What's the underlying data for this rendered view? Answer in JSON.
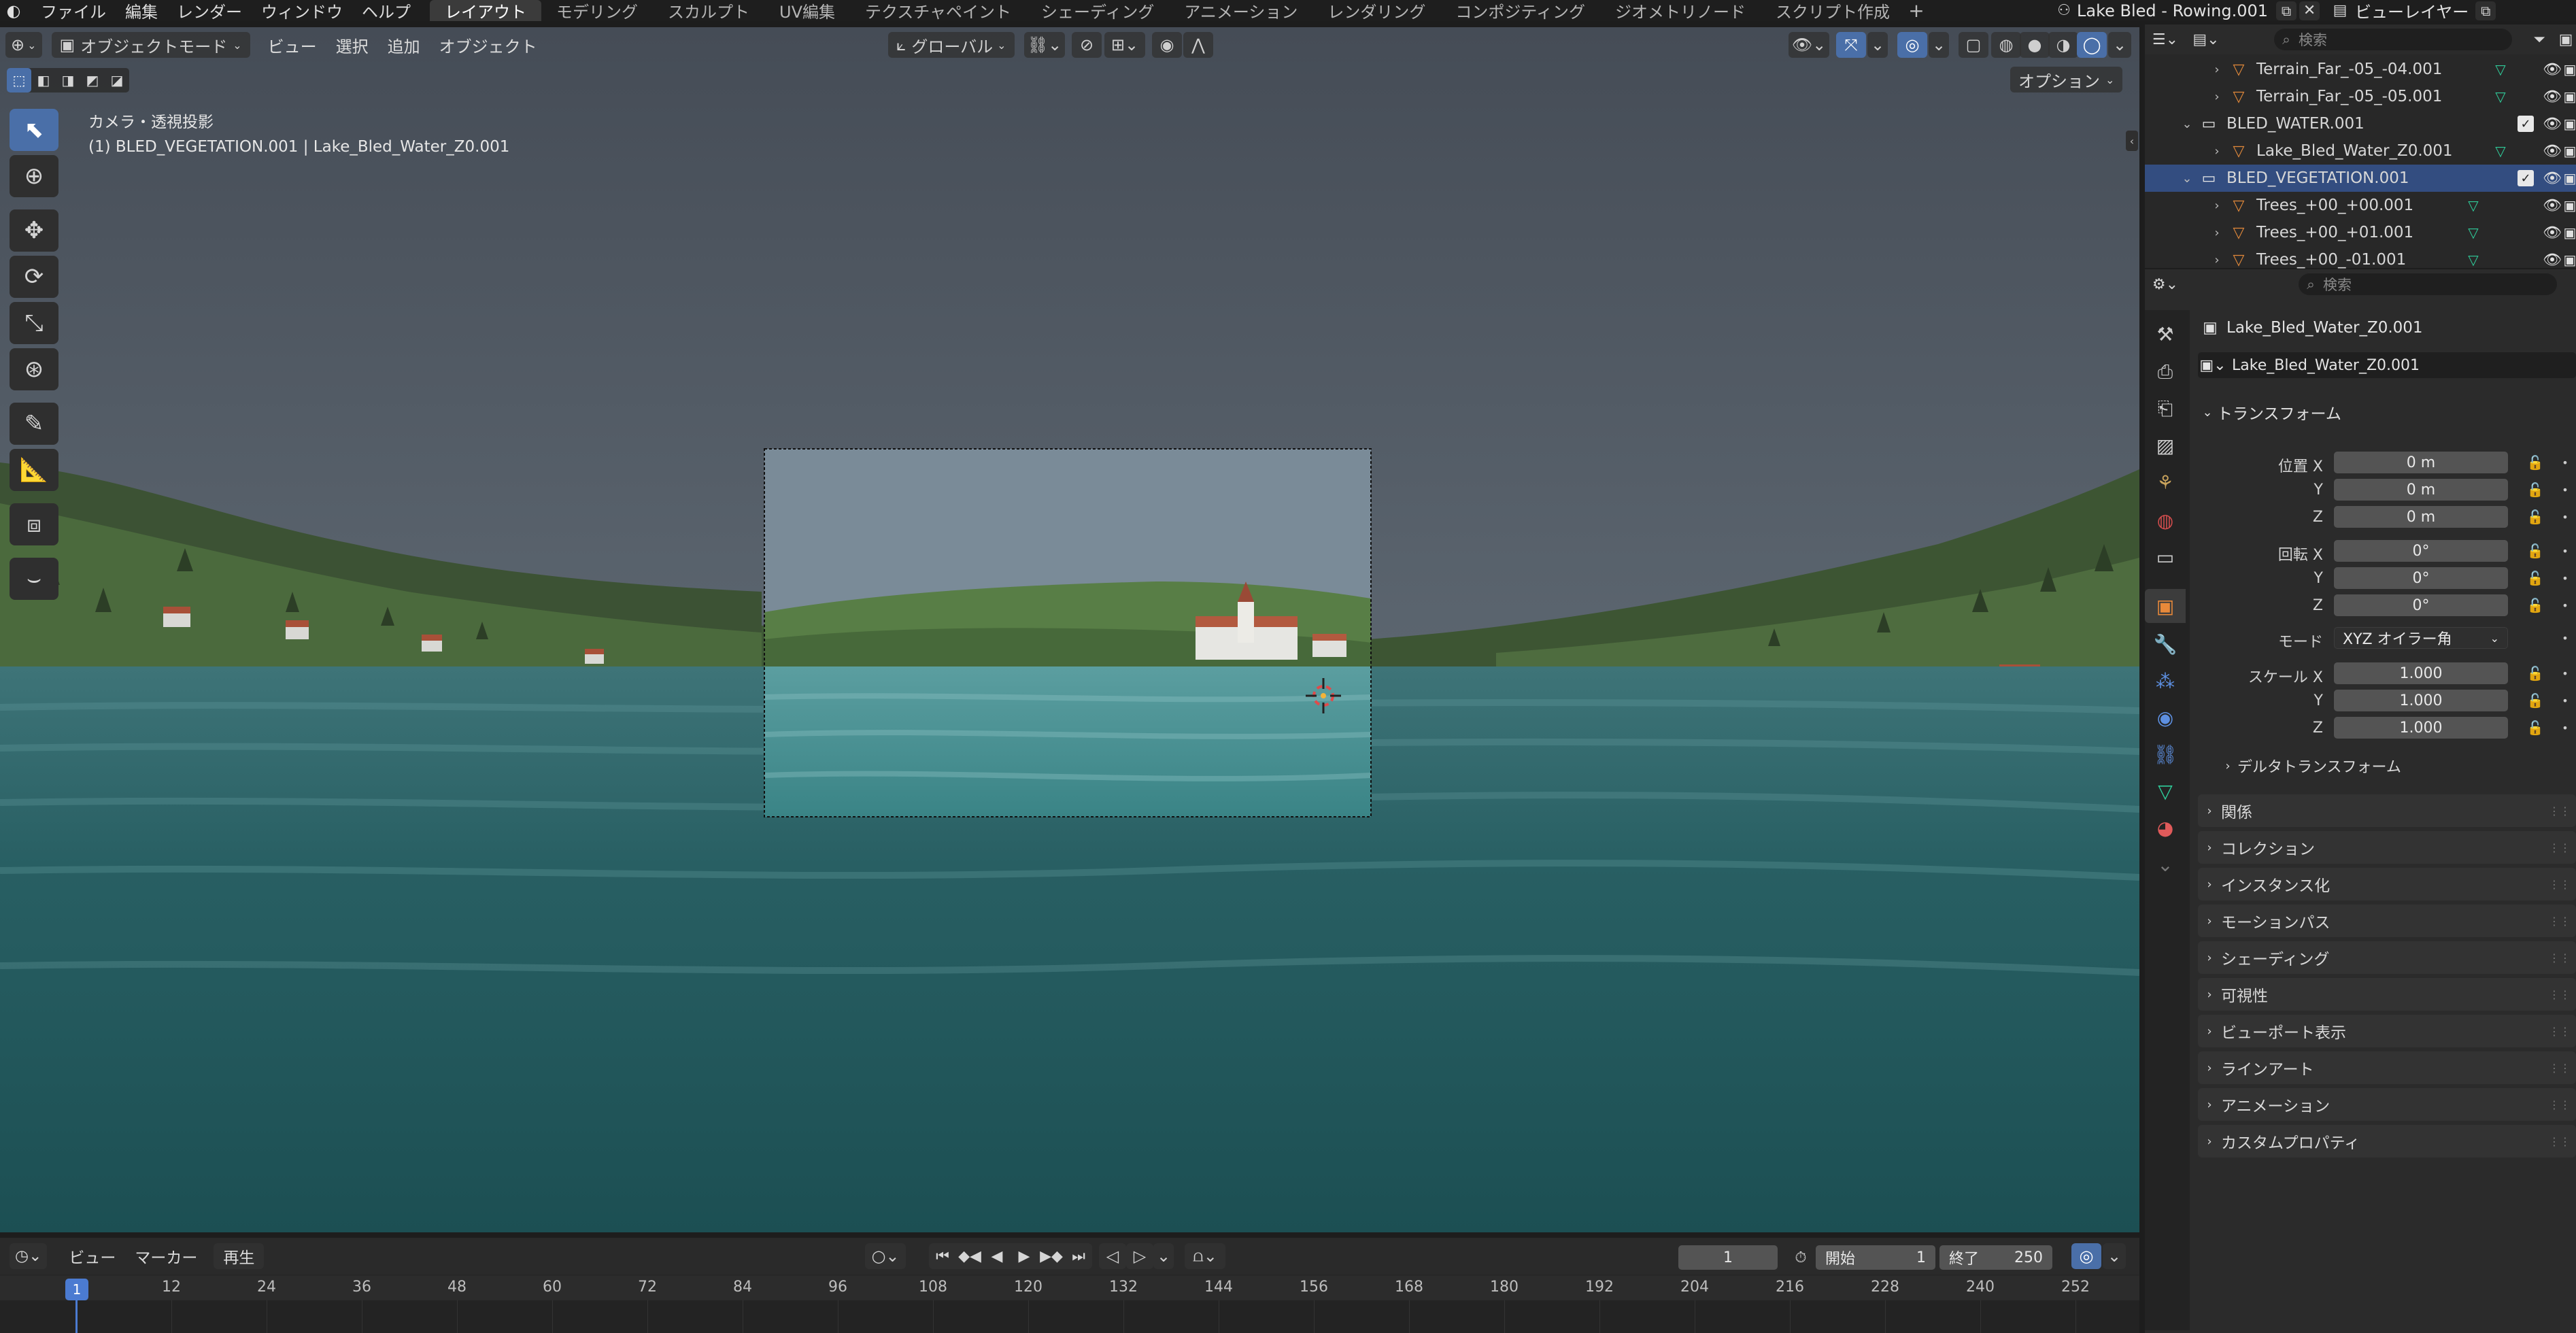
{
  "topbar": {
    "menus": [
      "ファイル",
      "編集",
      "レンダー",
      "ウィンドウ",
      "ヘルプ"
    ],
    "workspaces": [
      "レイアウト",
      "モデリング",
      "スカルプト",
      "UV編集",
      "テクスチャペイント",
      "シェーディング",
      "アニメーション",
      "レンダリング",
      "コンポジティング",
      "ジオメトリノード",
      "スクリプト作成"
    ],
    "add_tab": "+",
    "scene_name": "Lake Bled - Rowing.001",
    "view_layer": "ビューレイヤー"
  },
  "viewport": {
    "mode": "オブジェクトモード",
    "menus": [
      "ビュー",
      "選択",
      "追加",
      "オブジェクト"
    ],
    "orientation": "グローバル",
    "options": "オプション",
    "info_line1": "カメラ・透視投影",
    "info_line2": "(1) BLED_VEGETATION.001 | Lake_Bled_Water_Z0.001"
  },
  "outliner": {
    "search_placeholder": "検索",
    "rows": [
      {
        "name": "Terrain_Far_-05_-04.001",
        "indent": 2,
        "type": "mesh"
      },
      {
        "name": "Terrain_Far_-05_-05.001",
        "indent": 2,
        "type": "mesh"
      },
      {
        "name": "BLED_WATER.001",
        "indent": 1,
        "type": "collection"
      },
      {
        "name": "Lake_Bled_Water_Z0.001",
        "indent": 2,
        "type": "mesh"
      },
      {
        "name": "BLED_VEGETATION.001",
        "indent": 1,
        "type": "collection",
        "selected": true
      },
      {
        "name": "Trees_+00_+00.001",
        "indent": 2,
        "type": "mesh"
      },
      {
        "name": "Trees_+00_+01.001",
        "indent": 2,
        "type": "mesh"
      },
      {
        "name": "Trees_+00_-01.001",
        "indent": 2,
        "type": "mesh"
      }
    ]
  },
  "properties": {
    "search_placeholder": "検索",
    "object_name": "Lake_Bled_Water_Z0.001",
    "object_field": "Lake_Bled_Water_Z0.001",
    "transform_header": "トランスフォーム",
    "location_label": "位置 X",
    "rotation_label": "回転 X",
    "scale_label": "スケール X",
    "y_label": "Y",
    "z_label": "Z",
    "location": [
      "0 m",
      "0 m",
      "0 m"
    ],
    "rotation": [
      "0°",
      "0°",
      "0°"
    ],
    "mode_label": "モード",
    "mode_value": "XYZ オイラー角",
    "scale": [
      "1.000",
      "1.000",
      "1.000"
    ],
    "delta_transform": "デルタトランスフォーム",
    "panels": [
      "関係",
      "コレクション",
      "インスタンス化",
      "モーションパス",
      "シェーディング",
      "可視性",
      "ビューポート表示",
      "ラインアート",
      "アニメーション",
      "カスタムプロパティ"
    ]
  },
  "timeline": {
    "menus": [
      "ビュー",
      "マーカー",
      "再生"
    ],
    "current_frame": "1",
    "start_label": "開始",
    "start_value": "1",
    "end_label": "終了",
    "end_value": "250",
    "ticks": [
      "1",
      "12",
      "24",
      "36",
      "48",
      "60",
      "72",
      "84",
      "96",
      "108",
      "120",
      "132",
      "144",
      "156",
      "168",
      "180",
      "192",
      "204",
      "216",
      "228",
      "240",
      "252"
    ]
  },
  "colors": {
    "accent": "#4a6fa8",
    "selected_row": "#334d80",
    "current_frame": "#4b7bd1",
    "mesh_icon": "#e0883a",
    "vertex_group": "#2fcc9a"
  }
}
